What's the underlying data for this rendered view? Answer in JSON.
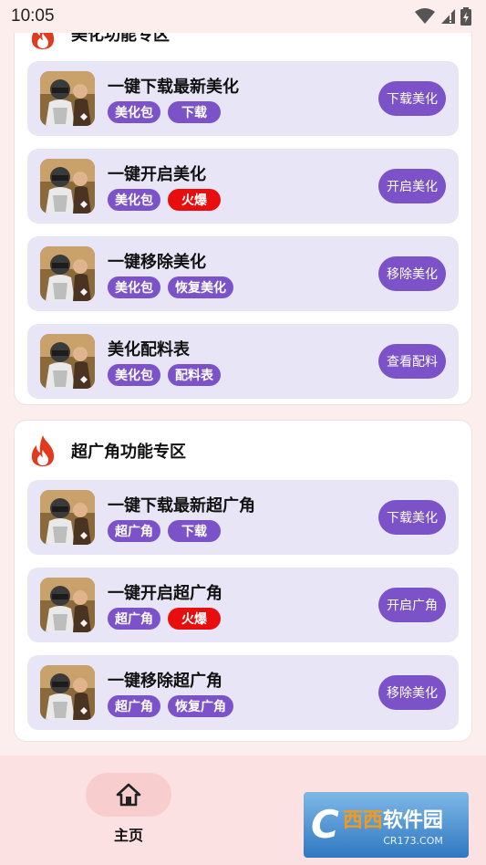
{
  "status_bar": {
    "time": "10:05",
    "icons": [
      "wifi-icon",
      "signal-icon",
      "battery-icon"
    ]
  },
  "section_beautify": {
    "title": "美化功能专区",
    "cards": [
      {
        "title": "一键下载最新美化",
        "tags": [
          "美化包",
          "下载"
        ],
        "hot_tag": false,
        "button": "下载美化"
      },
      {
        "title": "一键开启美化",
        "tags": [
          "美化包",
          "火爆"
        ],
        "hot_tag": true,
        "button": "开启美化"
      },
      {
        "title": "一键移除美化",
        "tags": [
          "美化包",
          "恢复美化"
        ],
        "hot_tag": false,
        "button": "移除美化"
      },
      {
        "title": "美化配料表",
        "tags": [
          "美化包",
          "配料表"
        ],
        "hot_tag": false,
        "button": "查看配料"
      }
    ]
  },
  "section_wide": {
    "title": "超广角功能专区",
    "cards": [
      {
        "title": "一键下载最新超广角",
        "tags": [
          "超广角",
          "下载"
        ],
        "hot_tag": false,
        "button": "下载美化"
      },
      {
        "title": "一键开启超广角",
        "tags": [
          "超广角",
          "火爆"
        ],
        "hot_tag": true,
        "button": "开启广角"
      },
      {
        "title": "一键移除超广角",
        "tags": [
          "超广角",
          "恢复广角"
        ],
        "hot_tag": false,
        "button": "移除美化"
      }
    ]
  },
  "bottom_nav": {
    "home_label": "主页",
    "home_icon": "home-icon",
    "user_icon": "users-icon"
  },
  "watermark": {
    "logo_letter": "C",
    "name_part1": "西西",
    "name_part2": "软件园",
    "url": "CR173.COM"
  },
  "colors": {
    "accent_purple": "#7b52c8",
    "hot_red": "#e80e0e",
    "card_bg": "#e8e6f6",
    "page_bg": "#fdeeee",
    "flame": "#e23a1e"
  }
}
